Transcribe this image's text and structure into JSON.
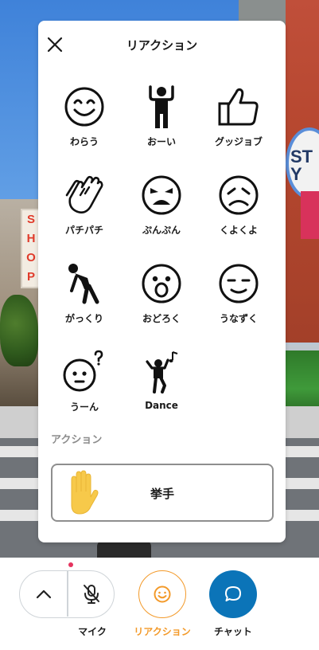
{
  "panel": {
    "title": "リアクション",
    "reactions": [
      {
        "label": "わらう",
        "icon": "smile-face-icon"
      },
      {
        "label": "おーい",
        "icon": "person-waving-arms-icon"
      },
      {
        "label": "グッジョブ",
        "icon": "thumbs-up-icon"
      },
      {
        "label": "パチパチ",
        "icon": "clapping-hands-icon"
      },
      {
        "label": "ぷんぷん",
        "icon": "angry-face-icon"
      },
      {
        "label": "くよくよ",
        "icon": "sad-face-icon"
      },
      {
        "label": "がっくり",
        "icon": "slumped-person-icon"
      },
      {
        "label": "おどろく",
        "icon": "surprised-face-icon"
      },
      {
        "label": "うなずく",
        "icon": "nodding-face-icon"
      },
      {
        "label": "うーん",
        "icon": "thinking-face-icon"
      },
      {
        "label": "Dance",
        "icon": "dancing-person-icon"
      }
    ],
    "action_section_label": "アクション",
    "action_button_label": "挙手"
  },
  "bottom_bar": {
    "mic_label": "マイク",
    "reaction_label": "リアクション",
    "chat_label": "チャット"
  },
  "colors": {
    "accent_orange": "#f39a2a",
    "chat_blue": "#0b74b8",
    "mic_dot": "#e5345e"
  }
}
